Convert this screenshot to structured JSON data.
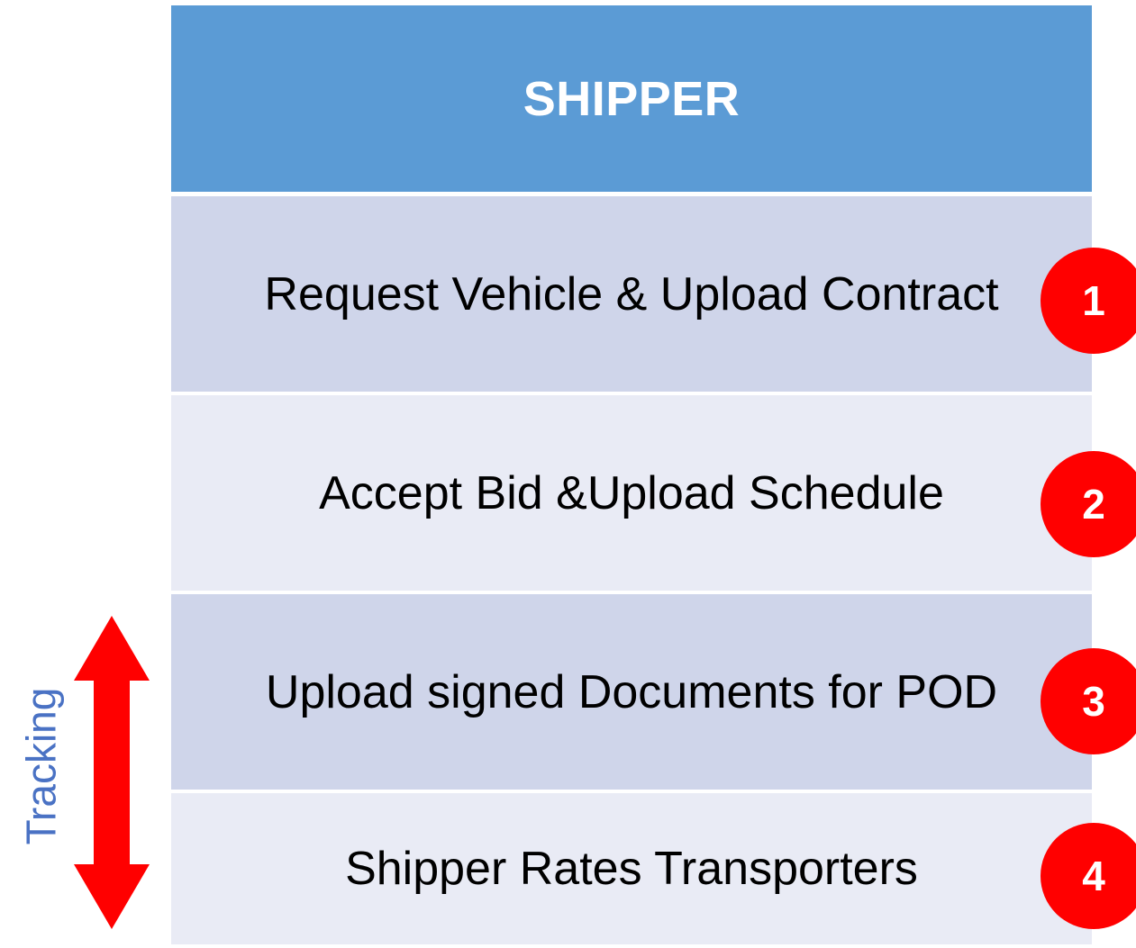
{
  "header": {
    "title": "SHIPPER"
  },
  "steps": [
    {
      "label": "Request Vehicle & Upload Contract",
      "number": "1"
    },
    {
      "label": "Accept Bid &Upload Schedule",
      "number": "2"
    },
    {
      "label": "Upload signed Documents for POD",
      "number": "3"
    },
    {
      "label": "Shipper Rates Transporters",
      "number": "4"
    }
  ],
  "side": {
    "label": "Tracking",
    "arrow_icon": "double-arrow-icon"
  },
  "colors": {
    "header_bg": "#5b9bd5",
    "row_dark": "#cfd5ea",
    "row_light": "#e9ebf5",
    "badge": "#ff0000",
    "arrow": "#ff0000",
    "label_text": "#4a72c4"
  }
}
